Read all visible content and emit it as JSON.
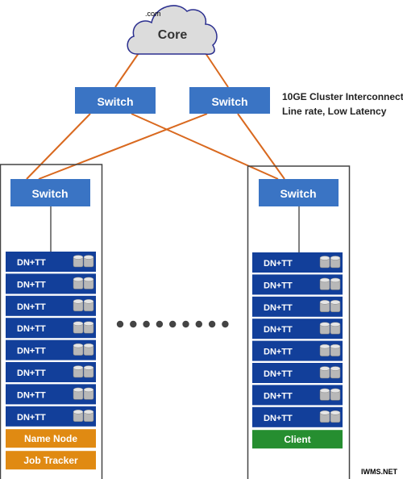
{
  "watermark_top": ".com",
  "watermark_bottom": "IWMS.NET",
  "core": {
    "label": "Core"
  },
  "top_switches": [
    {
      "label": "Switch"
    },
    {
      "label": "Switch"
    }
  ],
  "interconnect_note": {
    "line1": "10GE Cluster Interconnect",
    "line2": "Line rate, Low Latency"
  },
  "racks": [
    {
      "switch_label": "Switch",
      "nodes": [
        "DN+TT",
        "DN+TT",
        "DN+TT",
        "DN+TT",
        "DN+TT",
        "DN+TT",
        "DN+TT",
        "DN+TT"
      ],
      "extras": [
        {
          "label": "Name Node",
          "color": "#e08a12"
        },
        {
          "label": "Job Tracker",
          "color": "#e08a12"
        }
      ]
    },
    {
      "switch_label": "Switch",
      "nodes": [
        "DN+TT",
        "DN+TT",
        "DN+TT",
        "DN+TT",
        "DN+TT",
        "DN+TT",
        "DN+TT",
        "DN+TT"
      ],
      "extras": [
        {
          "label": "Client",
          "color": "#268e30"
        }
      ]
    }
  ],
  "ellipsis_dots": 9,
  "colors": {
    "switch": "#3a74c4",
    "node": "#123f9a",
    "link": "#d9691f",
    "cloud": "#dcdcdc",
    "cloud_stroke": "#2b2f8f"
  },
  "icons": {
    "node_icon": "disk-drives-icon"
  }
}
